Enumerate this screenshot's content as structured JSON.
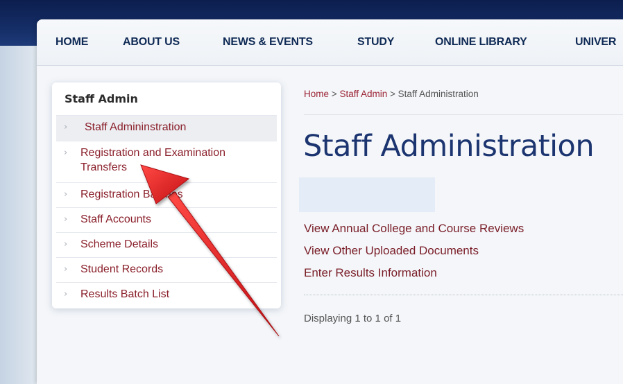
{
  "nav": {
    "items": [
      {
        "label": "HOME"
      },
      {
        "label": "ABOUT US"
      },
      {
        "label": "NEWS & EVENTS"
      },
      {
        "label": "STUDY"
      },
      {
        "label": "ONLINE LIBRARY"
      },
      {
        "label": "UNIVER"
      }
    ]
  },
  "sidebar": {
    "title": "Staff Admin",
    "items": [
      {
        "label": "Staff Admininstration"
      },
      {
        "label": "Registration and Examination Transfers"
      },
      {
        "label": "Registration Batches"
      },
      {
        "label": "Staff Accounts"
      },
      {
        "label": "Scheme Details"
      },
      {
        "label": "Student Records"
      },
      {
        "label": "Results Batch List"
      }
    ]
  },
  "breadcrumb": {
    "home": "Home",
    "sep1": ">",
    "section": "Staff Admin",
    "sep2": ">",
    "current": "Staff Administration"
  },
  "main": {
    "title": "Staff Administration",
    "links": [
      "View Annual College and Course Reviews",
      "View Other Uploaded Documents",
      "Enter Results Information"
    ],
    "paging": "Displaying 1 to 1 of 1"
  },
  "colors": {
    "nav_text": "#0f2a55",
    "title": "#1c3570",
    "link": "#7a1d28",
    "sidebar_link": "#8a1f2a",
    "arrow": "#e0181c"
  },
  "icons": {
    "sidebar_bullet": "chevron-right-icon"
  }
}
